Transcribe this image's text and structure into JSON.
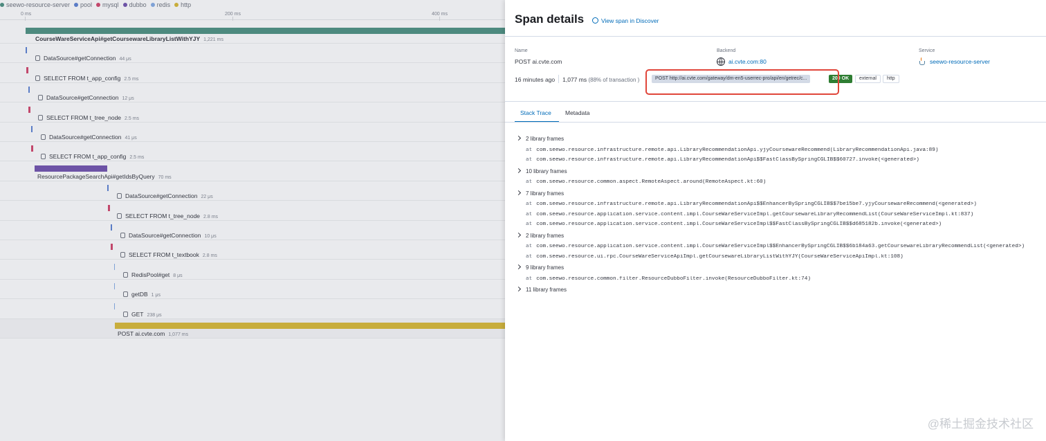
{
  "legend": [
    {
      "label": "seewo-resource-server",
      "color": "#4d8a7f"
    },
    {
      "label": "pool",
      "color": "#5a7cc6"
    },
    {
      "label": "mysql",
      "color": "#c2476b"
    },
    {
      "label": "dubbo",
      "color": "#6d53a6"
    },
    {
      "label": "redis",
      "color": "#7fa2d6"
    },
    {
      "label": "http",
      "color": "#c8ad3c"
    }
  ],
  "axis": [
    "0 ms",
    "200 ms",
    "400 ms"
  ],
  "spans": [
    {
      "name": "CourseWareServiceApi#getCoursewareLibraryListWithYJY",
      "duration": "1,221 ms",
      "color": "#4d8a7f",
      "bold": true,
      "icon": "rpc-icon"
    },
    {
      "name": "DataSource#getConnection",
      "duration": "44 μs",
      "color": "#5a7cc6",
      "icon": "db-icon"
    },
    {
      "name": "SELECT FROM t_app_config",
      "duration": "2.5 ms",
      "color": "#c2476b",
      "icon": "db-icon"
    },
    {
      "name": "DataSource#getConnection",
      "duration": "12 μs",
      "color": "#5a7cc6",
      "icon": "db-icon"
    },
    {
      "name": "SELECT FROM t_tree_node",
      "duration": "2.5 ms",
      "color": "#c2476b",
      "icon": "db-icon"
    },
    {
      "name": "DataSource#getConnection",
      "duration": "41 μs",
      "color": "#5a7cc6",
      "icon": "db-icon"
    },
    {
      "name": "SELECT FROM t_app_config",
      "duration": "2.5 ms",
      "color": "#c2476b",
      "icon": "db-icon"
    },
    {
      "name": "ResourcePackageSearchApi#getIdsByQuery",
      "duration": "70 ms",
      "color": "#6d53a6",
      "icon": ""
    },
    {
      "name": "DataSource#getConnection",
      "duration": "22 μs",
      "color": "#5a7cc6",
      "icon": "db-icon"
    },
    {
      "name": "SELECT FROM t_tree_node",
      "duration": "2.8 ms",
      "color": "#c2476b",
      "icon": "db-icon"
    },
    {
      "name": "DataSource#getConnection",
      "duration": "10 μs",
      "color": "#5a7cc6",
      "icon": "db-icon"
    },
    {
      "name": "SELECT FROM t_textbook",
      "duration": "2.8 ms",
      "color": "#c2476b",
      "icon": "db-icon"
    },
    {
      "name": "RedisPool#get",
      "duration": "8 μs",
      "color": "#7fa2d6",
      "icon": "db-icon"
    },
    {
      "name": "getDB",
      "duration": "1 μs",
      "color": "#7fa2d6",
      "icon": "db-icon"
    },
    {
      "name": "GET",
      "duration": "238 μs",
      "color": "#7fa2d6",
      "icon": "db-icon"
    },
    {
      "name": "POST ai.cvte.com",
      "duration": "1,077 ms",
      "color": "#c8ad3c",
      "icon": ""
    }
  ],
  "flyout": {
    "title": "Span details",
    "discover_link": "View span in Discover",
    "name_label": "Name",
    "name_value": "POST ai.cvte.com",
    "backend_label": "Backend",
    "backend_value": "ai.cvte.com:80",
    "service_label": "Service",
    "service_value": "seewo-resource-server",
    "time_ago": "16 minutes ago",
    "duration": "1,077 ms",
    "duration_pct": "(88% of transaction )",
    "url_badge": "POST http://ai.cvte.com/gateway/dm-en5-userrec-pro/api/en/getrec/c...",
    "status_badge": "200 OK",
    "tag_external": "external",
    "tag_http": "http",
    "tabs": [
      "Stack Trace",
      "Metadata"
    ],
    "active_tab": "Stack Trace"
  },
  "stacktrace": [
    {
      "type": "lib",
      "text": "2 library frames"
    },
    {
      "type": "at",
      "text": "com.seewo.resource.infrastructure.remote.api.LibraryRecommendationApi.yjyCoursewareRecommend(LibraryRecommendationApi.java:89)"
    },
    {
      "type": "at",
      "text": "com.seewo.resource.infrastructure.remote.api.LibraryRecommendationApi$$FastClassBySpringCGLIB$$60727.invoke(<generated>)"
    },
    {
      "type": "lib",
      "text": "10 library frames"
    },
    {
      "type": "at",
      "text": "com.seewo.resource.common.aspect.RemoteAspect.around(RemoteAspect.kt:60)"
    },
    {
      "type": "lib",
      "text": "7 library frames"
    },
    {
      "type": "at",
      "text": "com.seewo.resource.infrastructure.remote.api.LibraryRecommendationApi$$EnhancerBySpringCGLIB$$7be15be7.yjyCoursewareRecommend(<generated>)"
    },
    {
      "type": "at",
      "text": "com.seewo.resource.application.service.content.impl.CourseWareServiceImpl.getCoursewareLibraryRecommendList(CourseWareServiceImpl.kt:837)"
    },
    {
      "type": "at",
      "text": "com.seewo.resource.application.service.content.impl.CourseWareServiceImpl$$FastClassBySpringCGLIB$$d685182b.invoke(<generated>)"
    },
    {
      "type": "lib",
      "text": "2 library frames"
    },
    {
      "type": "at",
      "text": "com.seewo.resource.application.service.content.impl.CourseWareServiceImpl$$EnhancerBySpringCGLIB$$6b184a63.getCoursewareLibraryRecommendList(<generated>)"
    },
    {
      "type": "at",
      "text": "com.seewo.resource.ui.rpc.CourseWareServiceApiImpl.getCoursewareLibraryListWithYJY(CourseWareServiceApiImpl.kt:108)"
    },
    {
      "type": "lib",
      "text": "9 library frames"
    },
    {
      "type": "at",
      "text": "com.seewo.resource.common.filter.ResourceDubboFilter.invoke(ResourceDubboFilter.kt:74)"
    },
    {
      "type": "lib",
      "text": "11 library frames"
    }
  ],
  "stack_at_prefix": "at",
  "watermark": "@稀土掘金技术社区"
}
